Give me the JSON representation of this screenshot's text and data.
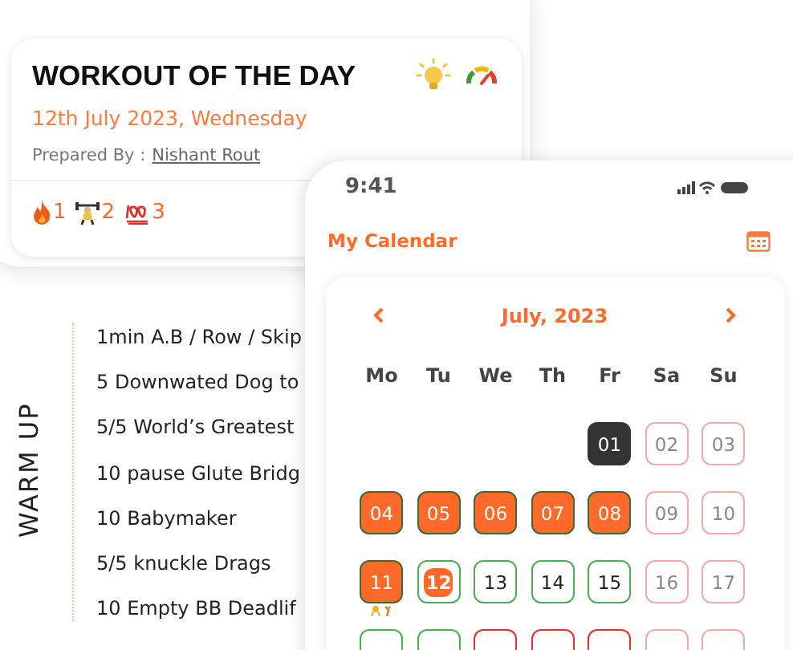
{
  "workout_card": {
    "title": "WORKOUT OF THE DAY",
    "date": "12th July 2023, Wednesday",
    "prepared_by_label": "Prepared By :",
    "author": "Nishant Rout",
    "reactions": [
      {
        "kind": "fire",
        "count": "1"
      },
      {
        "kind": "lift",
        "count": "2"
      },
      {
        "kind": "hundred",
        "count": "3"
      }
    ]
  },
  "warm_up": {
    "heading": "WARM UP",
    "items": [
      "1min A.B / Row / Skip",
      "5 Downwated Dog to",
      "5/5 World’s Greatest",
      "10 pause Glute Bridg",
      "10 Babymaker",
      "5/5 knuckle Drags",
      "10 Empty BB Deadlif"
    ]
  },
  "phone": {
    "time": "9:41",
    "title": "My Calendar",
    "calendar": {
      "month": "July, 2023",
      "weekdays": [
        "Mo",
        "Tu",
        "We",
        "Th",
        "Fr",
        "Sa",
        "Su"
      ],
      "days": [
        {
          "kind": "blank"
        },
        {
          "kind": "blank"
        },
        {
          "kind": "blank"
        },
        {
          "kind": "blank"
        },
        {
          "label": "01",
          "kind": "dark"
        },
        {
          "label": "02",
          "kind": "weekend"
        },
        {
          "label": "03",
          "kind": "weekend"
        },
        {
          "label": "04",
          "kind": "done"
        },
        {
          "label": "05",
          "kind": "done"
        },
        {
          "label": "06",
          "kind": "done"
        },
        {
          "label": "07",
          "kind": "done"
        },
        {
          "label": "08",
          "kind": "done"
        },
        {
          "label": "09",
          "kind": "weekend"
        },
        {
          "label": "10",
          "kind": "weekend"
        },
        {
          "label": "11",
          "kind": "done",
          "badges": true
        },
        {
          "label": "12",
          "kind": "today",
          "selected": true
        },
        {
          "label": "13",
          "kind": "upcoming"
        },
        {
          "label": "14",
          "kind": "upcoming"
        },
        {
          "label": "15",
          "kind": "upcoming"
        },
        {
          "label": "16",
          "kind": "weekend"
        },
        {
          "label": "17",
          "kind": "weekend"
        },
        {
          "kind": "upcoming"
        },
        {
          "kind": "upcoming"
        },
        {
          "kind": "missed"
        },
        {
          "kind": "missed"
        },
        {
          "kind": "missed"
        },
        {
          "kind": "weekend"
        },
        {
          "kind": "weekend"
        }
      ]
    }
  }
}
